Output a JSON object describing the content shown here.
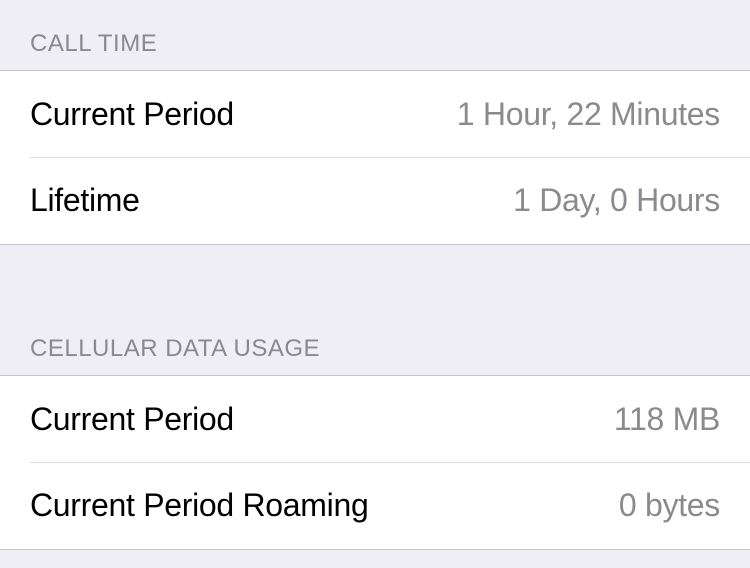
{
  "sections": {
    "call_time": {
      "header": "CALL TIME",
      "rows": [
        {
          "label": "Current Period",
          "value": "1 Hour, 22 Minutes"
        },
        {
          "label": "Lifetime",
          "value": "1 Day, 0 Hours"
        }
      ]
    },
    "cellular_data_usage": {
      "header": "CELLULAR DATA USAGE",
      "rows": [
        {
          "label": "Current Period",
          "value": "118 MB"
        },
        {
          "label": "Current Period Roaming",
          "value": "0 bytes"
        }
      ]
    }
  }
}
